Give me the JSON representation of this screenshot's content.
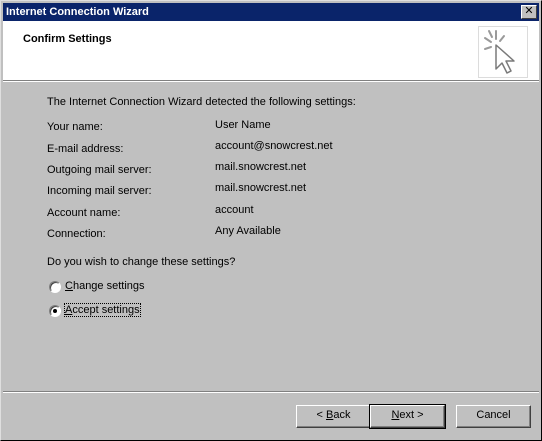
{
  "window": {
    "title": "Internet Connection Wizard"
  },
  "header": {
    "title": "Confirm Settings",
    "art_icon": "wizard-cursor-sparkle-icon"
  },
  "intro": "The Internet Connection Wizard detected the following settings:",
  "settings": [
    {
      "label": "Your name:",
      "value": "User Name"
    },
    {
      "label": "E-mail address:",
      "value": "account@snowcrest.net"
    },
    {
      "label": "Outgoing mail server:",
      "value": "mail.snowcrest.net"
    },
    {
      "label": "Incoming mail server:",
      "value": "mail.snowcrest.net"
    },
    {
      "label": "Account name:",
      "value": "account"
    },
    {
      "label": "Connection:",
      "value": "Any Available"
    }
  ],
  "question": "Do you wish to change these settings?",
  "options": {
    "change": {
      "label": "Change settings",
      "checked": false
    },
    "accept": {
      "label": "Accept settings",
      "checked": true
    }
  },
  "buttons": {
    "back": {
      "label": "< Back"
    },
    "next": {
      "label": "Next >"
    },
    "cancel": {
      "label": "Cancel"
    }
  }
}
